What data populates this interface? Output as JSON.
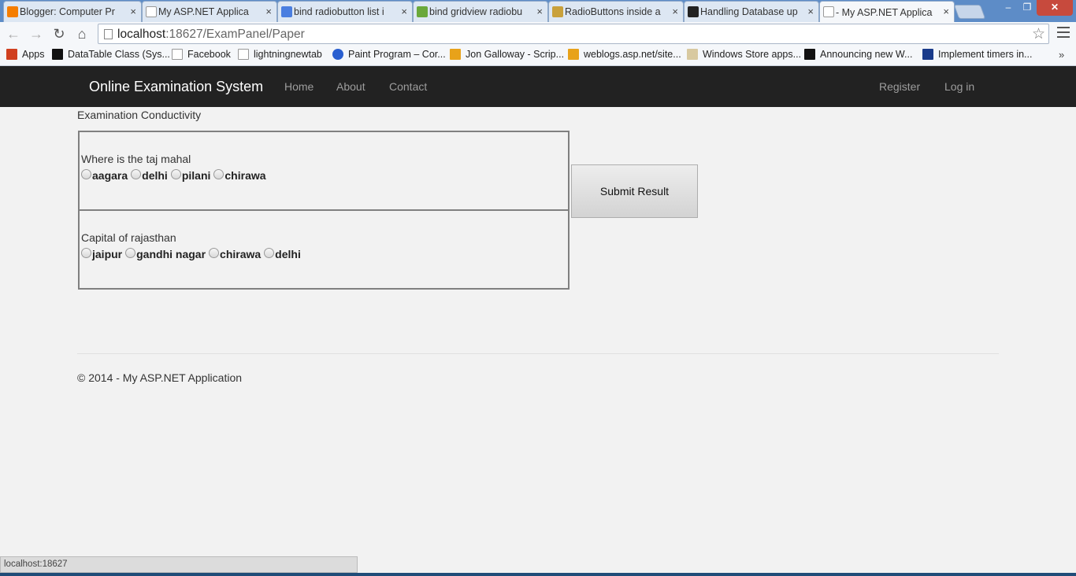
{
  "browser": {
    "tabs": [
      {
        "title": "Blogger: Computer Pr",
        "icon": "blogger-icon",
        "color": "#f57d00",
        "active": false
      },
      {
        "title": "My ASP.NET Applica",
        "icon": "page-icon",
        "color": "#ffffff",
        "active": false
      },
      {
        "title": "bind radiobutton list i",
        "icon": "google-icon",
        "color": "#4a7ee0",
        "active": false
      },
      {
        "title": "bind gridview radiobu",
        "icon": "windows-icon",
        "color": "#6aa83b",
        "active": false
      },
      {
        "title": "RadioButtons inside a",
        "icon": "forum-icon",
        "color": "#c9a13b",
        "active": false
      },
      {
        "title": "Handling Database up",
        "icon": "codeproject-icon",
        "color": "#222222",
        "active": false
      },
      {
        "title": "- My ASP.NET Applica",
        "icon": "page-icon",
        "color": "#ffffff",
        "active": true
      }
    ],
    "tab_close_glyph": "×",
    "window_controls": {
      "minimize": "–",
      "restore": "❐",
      "close": "✕"
    },
    "url_host": "localhost",
    "url_path": ":18627/ExamPanel/Paper",
    "bookmarks": [
      {
        "label": "Apps",
        "icon": "apps-icon",
        "color": "#d04020"
      },
      {
        "label": "DataTable Class (Sys...",
        "icon": "msdn-icon",
        "color": "#111111"
      },
      {
        "label": "Facebook",
        "icon": "page-icon",
        "color": "#ffffff"
      },
      {
        "label": "lightningnewtab",
        "icon": "page-icon",
        "color": "#ffffff"
      },
      {
        "label": "Paint Program – Cor...",
        "icon": "globe-icon",
        "color": "#2a5fd0"
      },
      {
        "label": "Jon Galloway - Scrip...",
        "icon": "windows-icon",
        "color": "#e8a21a"
      },
      {
        "label": "weblogs.asp.net/site...",
        "icon": "windows-icon",
        "color": "#e8a21a"
      },
      {
        "label": "Windows Store apps...",
        "icon": "store-icon",
        "color": "#d8c9a0"
      },
      {
        "label": "Announcing new W...",
        "icon": "msdn-icon",
        "color": "#111111"
      },
      {
        "label": "Implement timers in...",
        "icon": "n-icon",
        "color": "#1a3b8a"
      }
    ],
    "bookmarks_more": "»",
    "status_text": "localhost:18627"
  },
  "site": {
    "brand": "Online Examination System",
    "nav": [
      "Home",
      "About",
      "Contact"
    ],
    "nav_right": [
      "Register",
      "Log in"
    ],
    "subtitle": "Examination Conductivity",
    "questions": [
      {
        "text": "Where is the taj mahal",
        "options": [
          "aagara",
          "delhi",
          "pilani",
          "chirawa"
        ]
      },
      {
        "text": "Capital of rajasthan",
        "options": [
          "jaipur",
          "gandhi nagar",
          "chirawa",
          "delhi"
        ]
      }
    ],
    "submit_label": "Submit Result",
    "footer": "© 2014 - My ASP.NET Application"
  }
}
